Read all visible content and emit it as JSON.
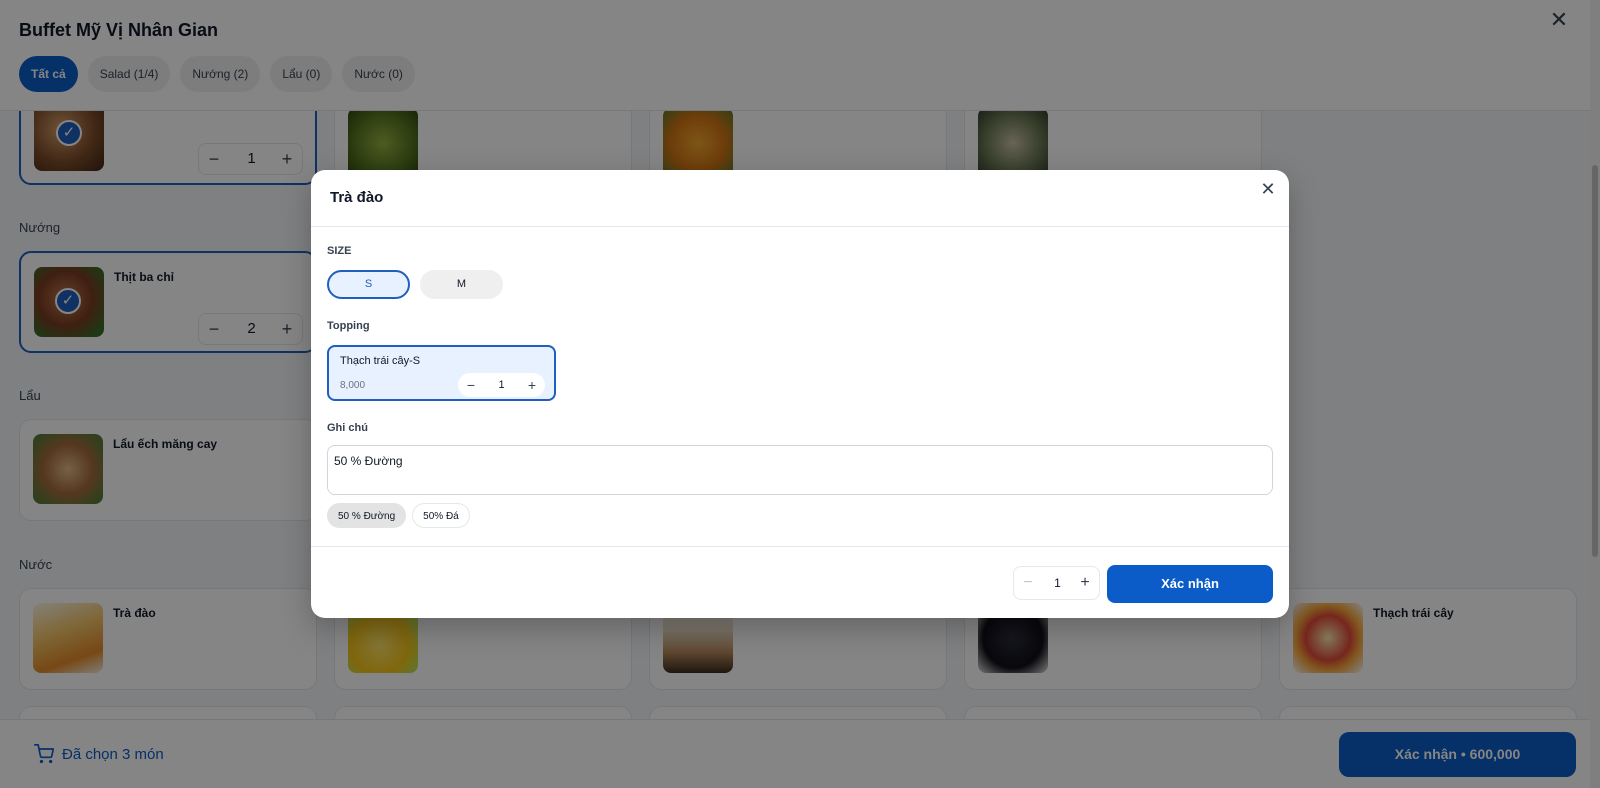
{
  "page": {
    "title": "Buffet Mỹ Vị Nhân Gian",
    "close_icon": "close-icon"
  },
  "tabs": [
    {
      "label": "Tất cả",
      "active": true
    },
    {
      "label": "Salad (1/4)",
      "active": false
    },
    {
      "label": "Nướng (2)",
      "active": false
    },
    {
      "label": "Lẩu (0)",
      "active": false
    },
    {
      "label": "Nước (0)",
      "active": false
    }
  ],
  "sections": {
    "salad": {
      "first_item_qty": "1",
      "first_item_selected": true
    },
    "nuong": {
      "label": "Nướng",
      "items": [
        {
          "name": "Thịt ba chỉ",
          "qty": "2",
          "selected": true
        }
      ]
    },
    "lau": {
      "label": "Lẩu",
      "items": [
        {
          "name": "Lẩu ếch măng cay"
        }
      ]
    },
    "nuoc": {
      "label": "Nước",
      "items": [
        {
          "name": "Trà đào"
        },
        {
          "name": ""
        },
        {
          "name": ""
        },
        {
          "name": ""
        },
        {
          "name": "Thạch trái cây"
        }
      ]
    }
  },
  "bottom_bar": {
    "cart_icon": "cart-icon",
    "cart_summary": "Đã chọn 3 món",
    "confirm_label": "Xác nhận • 600,000"
  },
  "modal": {
    "title": "Trà đào",
    "size_label": "SIZE",
    "sizes": [
      {
        "label": "S",
        "selected": true
      },
      {
        "label": "M",
        "selected": false
      }
    ],
    "topping_label": "Topping",
    "toppings": [
      {
        "name": "Thạch trái cây-S",
        "price": "8,000",
        "qty": "1",
        "selected": true
      }
    ],
    "note_label": "Ghi chú",
    "note_value": "50 % Đường",
    "note_chips": [
      {
        "label": "50 % Đường",
        "active": true
      },
      {
        "label": "50% Đá",
        "active": false
      }
    ],
    "quantity": "1",
    "confirm_label": "Xác nhận"
  },
  "colors": {
    "accent": "#0b5cc8",
    "selected_border": "#1f5fbf",
    "selected_fill": "#e8f1ff"
  }
}
